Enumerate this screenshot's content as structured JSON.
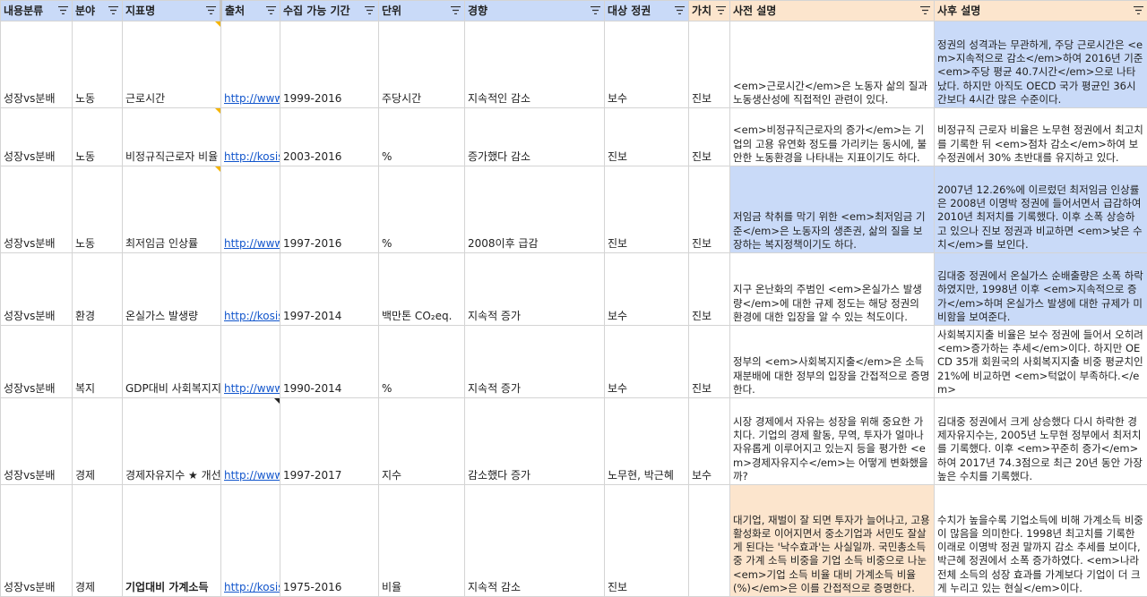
{
  "headers": {
    "category": "내용분류",
    "field": "분야",
    "indicator": "지표명",
    "source": "출처",
    "period": "수집 가능 기간",
    "unit": "단위",
    "trend": "경향",
    "target": "대상 정권",
    "value": "가치",
    "pre": "사전 설명",
    "post": "사후 설명"
  },
  "rows": [
    {
      "category": "성장vs분배",
      "field": "노동",
      "indicator": "근로시간",
      "source": "http://www",
      "period": "1999-2016",
      "unit": "주당시간",
      "trend": "지속적인 감소",
      "target": "보수",
      "value": "진보",
      "pre": "<em>근로시간</em>은 노동자 삶의 질과 노동생산성에 직접적인 관련이 있다.",
      "post": "정권의 성격과는 무관하게, 주당 근로시간은 <em>지속적으로 감소</em>하여 2016년 기준 <em>주당 평균 40.7시간</em>으로 나타났다. 하지만 아직도 OECD 국가 평균인 36시간보다 4시간 많은 수준이다."
    },
    {
      "category": "성장vs분배",
      "field": "노동",
      "indicator": "비정규직근로자 비율",
      "source": "http://kosis",
      "period": "2003-2016",
      "unit": "%",
      "trend": "증가했다 감소",
      "target": "진보",
      "value": "진보",
      "pre": "<em>비정규직근로자의 증가</em>는 기업의 고용 유연화 정도를 가리키는 동시에, 불안한 노동환경을 나타내는 지표이기도 하다.",
      "post": "비정규직 근로자 비율은 노무현 정권에서 최고치를 기록한 뒤 <em>점차 감소</em>하여 보수정권에서 30% 초반대를 유지하고 있다."
    },
    {
      "category": "성장vs분배",
      "field": "노동",
      "indicator": "최저임금 인상률",
      "source": "http://www",
      "period": "1997-2016",
      "unit": "%",
      "trend": "2008이후 급감",
      "target": "진보",
      "value": "진보",
      "pre": "저임금 착취를 막기 위한 <em>최저임금 기준</em>은 노동자의 생존권, 삶의 질을 보장하는 복지정책이기도 하다.",
      "post": "2007년 12.26%에 이르렀던 최저임금 인상률은 2008년 이명박 정권에 들어서면서 급감하여 2010년 최저치를 기록했다. 이후 소폭 상승하고 있으나 진보 정권과 비교하면 <em>낮은 수치</em>를 보인다."
    },
    {
      "category": "성장vs분배",
      "field": "환경",
      "indicator": "온실가스 발생량",
      "source": "http://kosis",
      "period": "1997-2014",
      "unit": "백만톤 CO₂eq.",
      "trend": "지속적 증가",
      "target": "보수",
      "value": "진보",
      "pre": "지구 온난화의 주범인 <em>온실가스 발생량</em>에 대한 규제 정도는 해당 정권의 환경에 대한 입장을 알 수 있는 척도이다.",
      "post": "김대중 정권에서 온실가스 순배출량은 소폭 하락하였지만, 1998년 이후 <em>지속적으로 증가</em>하며 온실가스 발생에 대한 규제가 미비함을 보여준다."
    },
    {
      "category": "성장vs분배",
      "field": "복지",
      "indicator": "GDP대비 사회복지지출",
      "source": "http://www",
      "period": "1990-2014",
      "unit": "%",
      "trend": "지속적 증가",
      "target": "보수",
      "value": "진보",
      "pre": "정부의 <em>사회복지지출</em>은 소득재분배에 대한 정부의 입장을 간접적으로 증명한다.",
      "post": "사회복지지출 비율은 보수 정권에 들어서 오히려 <em>증가하는 추세</em>이다. 하지만 OECD 35개 회원국의 사회복지지출 비중 평균치인 21%에 비교하면 <em>턱없이 부족하다.</em>"
    },
    {
      "category": "성장vs분배",
      "field": "경제",
      "indicator": "경제자유지수 ★ 개선",
      "source": "http://www",
      "period": "1997-2017",
      "unit": "지수",
      "trend": "감소했다 증가",
      "target": "노무현, 박근혜",
      "value": "보수",
      "pre": "시장 경제에서 자유는 성장을 위해 중요한 가치다. 기업의 경제 활동, 무역, 투자가 얼마나 자유롭게 이루어지고 있는지 등을 평가한 <em>경제자유지수</em>는 어떻게 변화했을까?",
      "post": "김대중 정권에서 크게 상승했다 다시 하락한 경제자유지수는, 2005년 노무현 정부에서 최저치를 기록했다. 이후 <em>꾸준히 증가</em>하여 2017년 74.3점으로 최근 20년 동안 가장 높은 수치를 기록했다."
    },
    {
      "category": "성장vs분배",
      "field": "경제",
      "indicator": "기업대비 가계소득",
      "source": "http://kosis",
      "period": "1975-2016",
      "unit": "비율",
      "trend": "지속적 감소",
      "target": "진보",
      "value": "",
      "pre": "대기업, 재벌이 잘 되면 투자가 늘어나고, 고용 활성화로 이어지면서 중소기업과 서민도 잘살게 된다는 '낙수효과'는 사실일까. 국민총소득 중 가계 소득 비중을 기업 소득 비중으로 나눈 <em>기업 소득 비율 대비 가계소득 비율(%)</em>은 이를 간접적으로 증명한다.",
      "post": "수치가 높을수록 기업소득에 비해 가계소득 비중이 많음을 의미한다. 1998년 최고치를 기록한 이래로 이명박 정권 말까지 감소 추세를 보이다, 박근혜 정권에서 소폭 증가하였다. <em>나라 전체 소득의 성장 효과를 가계보다 기업이 더 크게 누리고 있는 현실</em>이다."
    }
  ],
  "colors": {
    "header_blue": "#c9daf8",
    "header_orange": "#fce5cd",
    "note_marker": "#f4b400",
    "link": "#1155cc"
  },
  "icons": {
    "filter": "filter-icon",
    "note": "comment-marker"
  }
}
